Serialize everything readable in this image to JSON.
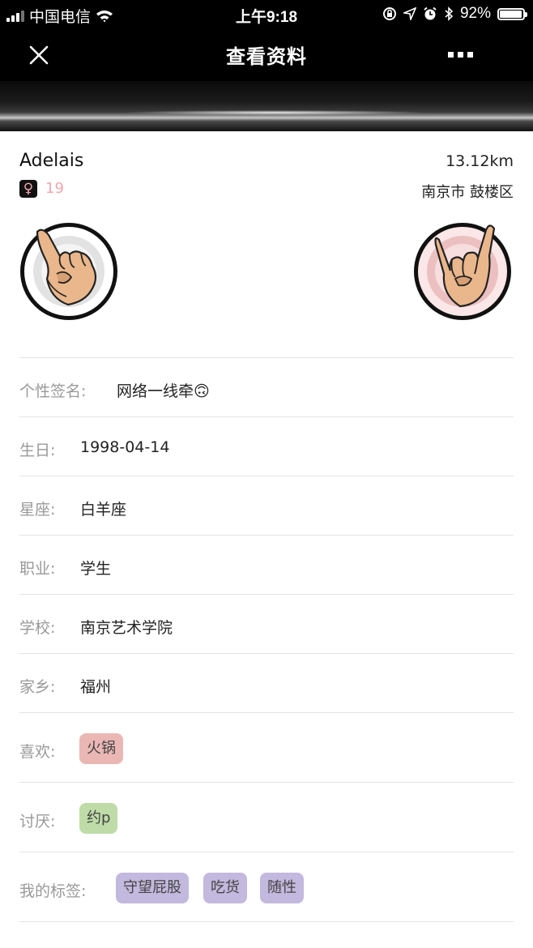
{
  "status_bar": {
    "carrier": "中国电信",
    "time": "上午9:18",
    "battery": "92%",
    "battery_level": 0.92
  },
  "nav": {
    "title": "查看资料",
    "close_icon": "close-icon",
    "more_icon": "more-icon"
  },
  "profile": {
    "name": "Adelais",
    "distance": "13.12km",
    "gender_symbol": "♀",
    "age": "19",
    "location": "南京市 鼓楼区"
  },
  "fields": [
    {
      "label": "个性签名:",
      "value": "网络一线牵🙃"
    },
    {
      "label": "生日:",
      "value": "1998-04-14"
    },
    {
      "label": "星座:",
      "value": "白羊座"
    },
    {
      "label": "职业:",
      "value": "学生"
    },
    {
      "label": "学校:",
      "value": "南京艺术学院"
    },
    {
      "label": "家乡:",
      "value": "福州"
    }
  ],
  "likes": {
    "label": "喜欢:",
    "tags": [
      "火锅"
    ]
  },
  "dislikes": {
    "label": "讨厌:",
    "tags": [
      "约p"
    ]
  },
  "my_tags": {
    "label": "我的标签:",
    "tags": [
      "守望屁股",
      "吃货",
      "随性"
    ]
  },
  "colors": {
    "like_tag": "#ebb7b5",
    "dislike_tag": "#bfdca8",
    "my_tag": "#c3b8dd",
    "age_pink": "#f0a7ae"
  }
}
